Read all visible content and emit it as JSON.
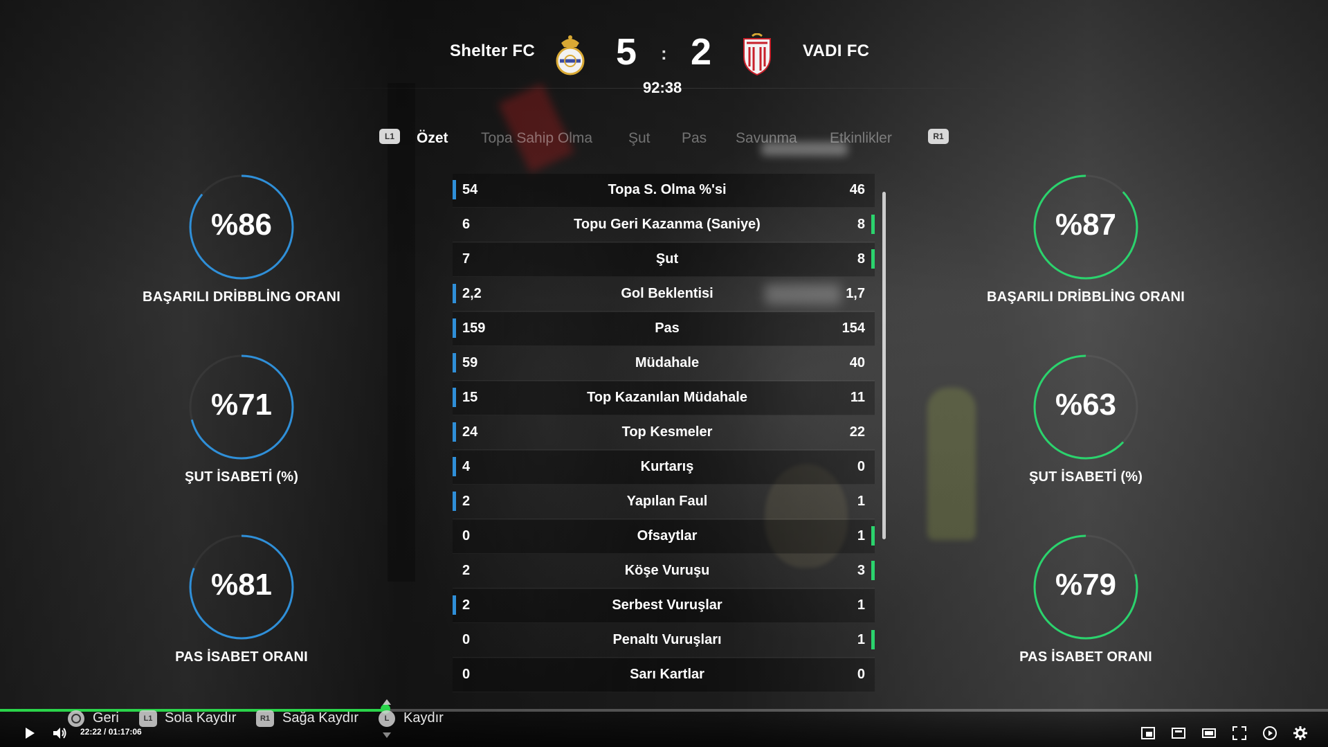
{
  "match": {
    "home_team": "Shelter FC",
    "away_team": "VADI FC",
    "home_score": "5",
    "away_score": "2",
    "separator": ":",
    "clock": "92:38"
  },
  "tabs": {
    "left_button": "L1",
    "right_button": "R1",
    "items": [
      {
        "label": "Özet",
        "active": true
      },
      {
        "label": "Topa Sahip Olma",
        "active": false
      },
      {
        "label": "Şut",
        "active": false
      },
      {
        "label": "Pas",
        "active": false
      },
      {
        "label": "Savunma",
        "active": false
      },
      {
        "label": "Etkinlikler",
        "active": false
      }
    ]
  },
  "stats": [
    {
      "label": "Topa S. Olma %'si",
      "home": "54",
      "away": "46",
      "leader": "home"
    },
    {
      "label": "Topu Geri Kazanma (Saniye)",
      "home": "6",
      "away": "8",
      "leader": "away"
    },
    {
      "label": "Şut",
      "home": "7",
      "away": "8",
      "leader": "away"
    },
    {
      "label": "Gol Beklentisi",
      "home": "2,2",
      "away": "1,7",
      "leader": "home"
    },
    {
      "label": "Pas",
      "home": "159",
      "away": "154",
      "leader": "home"
    },
    {
      "label": "Müdahale",
      "home": "59",
      "away": "40",
      "leader": "home"
    },
    {
      "label": "Top Kazanılan Müdahale",
      "home": "15",
      "away": "11",
      "leader": "home"
    },
    {
      "label": "Top Kesmeler",
      "home": "24",
      "away": "22",
      "leader": "home"
    },
    {
      "label": "Kurtarış",
      "home": "4",
      "away": "0",
      "leader": "home"
    },
    {
      "label": "Yapılan Faul",
      "home": "2",
      "away": "1",
      "leader": "home"
    },
    {
      "label": "Ofsaytlar",
      "home": "0",
      "away": "1",
      "leader": "away"
    },
    {
      "label": "Köşe Vuruşu",
      "home": "2",
      "away": "3",
      "leader": "away"
    },
    {
      "label": "Serbest Vuruşlar",
      "home": "2",
      "away": "1",
      "leader": "home"
    },
    {
      "label": "Penaltı Vuruşları",
      "home": "0",
      "away": "1",
      "leader": "away"
    },
    {
      "label": "Sarı Kartlar",
      "home": "0",
      "away": "0",
      "leader": "none"
    }
  ],
  "gauges": {
    "home": [
      {
        "value": "%86",
        "percent": 86,
        "label": "BAŞARILI DRİBBLİNG ORANI"
      },
      {
        "value": "%71",
        "percent": 71,
        "label": "ŞUT İSABETİ (%)"
      },
      {
        "value": "%81",
        "percent": 81,
        "label": "PAS İSABET ORANI"
      }
    ],
    "away": [
      {
        "value": "%87",
        "percent": 87,
        "label": "BAŞARILI DRİBBLİNG ORANI"
      },
      {
        "value": "%63",
        "percent": 63,
        "label": "ŞUT İSABETİ (%)"
      },
      {
        "value": "%79",
        "percent": 79,
        "label": "PAS İSABET ORANI"
      }
    ]
  },
  "colors": {
    "home_accent": "#2f8fd8",
    "away_accent": "#2bd36d",
    "progress": "#2ad44a"
  },
  "controls": {
    "back_label": "Geri",
    "scroll_left_label": "Sola Kaydır",
    "scroll_right_label": "Sağa Kaydır",
    "scroll_label": "Kaydır",
    "scroll_left_button": "L1",
    "scroll_right_button": "R1",
    "stick_button": "L"
  },
  "player": {
    "time_display": "22:22 / 01:17:06",
    "progress_fraction": 0.29,
    "icons": [
      "play-icon",
      "volume-icon",
      "miniplayer-icon",
      "cast-icon",
      "theater-icon",
      "fullscreen-icon",
      "autoplay-icon",
      "settings-icon"
    ]
  }
}
